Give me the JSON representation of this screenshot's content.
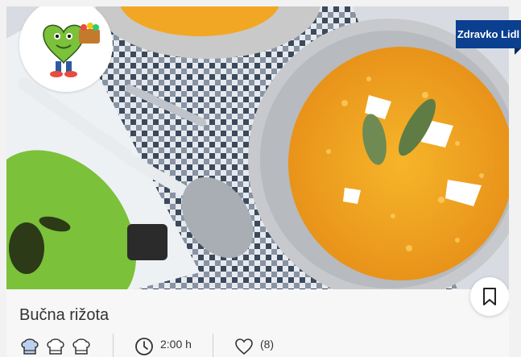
{
  "recipe": {
    "title": "Bučna rižota",
    "badge": "Zdravko Lidl",
    "time": "2:00 h",
    "likes": "(8)",
    "difficulty_level": 3,
    "difficulty_max": 3
  },
  "colors": {
    "badge_bg": "#0b3f8f",
    "risotto": "#f0a81c",
    "mascot_green": "#7bc13a"
  },
  "icons": {
    "chef_hat": "chef-hat-icon",
    "clock": "clock-icon",
    "heart": "heart-icon",
    "bookmark": "bookmark-icon"
  }
}
